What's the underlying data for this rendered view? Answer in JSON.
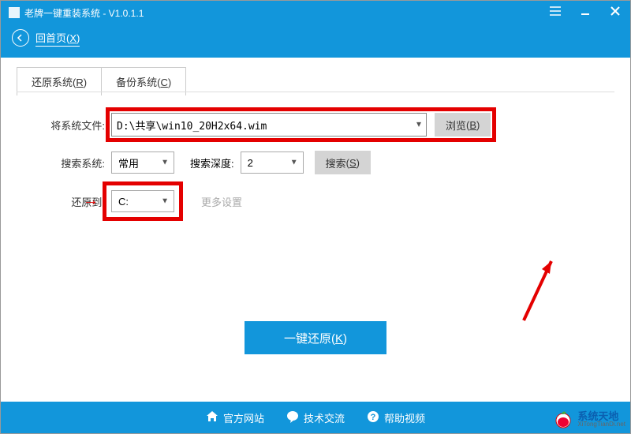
{
  "app": {
    "title": "老牌一键重装系统 - V1.0.1.1",
    "back_label": "回首页",
    "back_shortcut": "X"
  },
  "tabs": {
    "restore": {
      "label": "还原系统",
      "shortcut": "R"
    },
    "backup": {
      "label": "备份系统",
      "shortcut": "C"
    }
  },
  "form": {
    "file_label": "将系统文件:",
    "file_value": "D:\\共享\\win10_20H2x64.wim",
    "browse_label": "浏览",
    "browse_shortcut": "B",
    "search_sys_label": "搜索系统:",
    "search_sys_value": "常用",
    "search_depth_label": "搜索深度:",
    "search_depth_value": "2",
    "search_btn_label": "搜索",
    "search_btn_shortcut": "S",
    "restore_to_label": "还原到:",
    "restore_to_value": "C:",
    "more_settings": "更多设置"
  },
  "primary": {
    "label": "一键还原",
    "shortcut": "K"
  },
  "footer": {
    "site": "官方网站",
    "forum": "技术交流",
    "help": "帮助视频"
  },
  "watermark": {
    "cn": "系统天地",
    "en": "XiTongTianDi.net"
  }
}
